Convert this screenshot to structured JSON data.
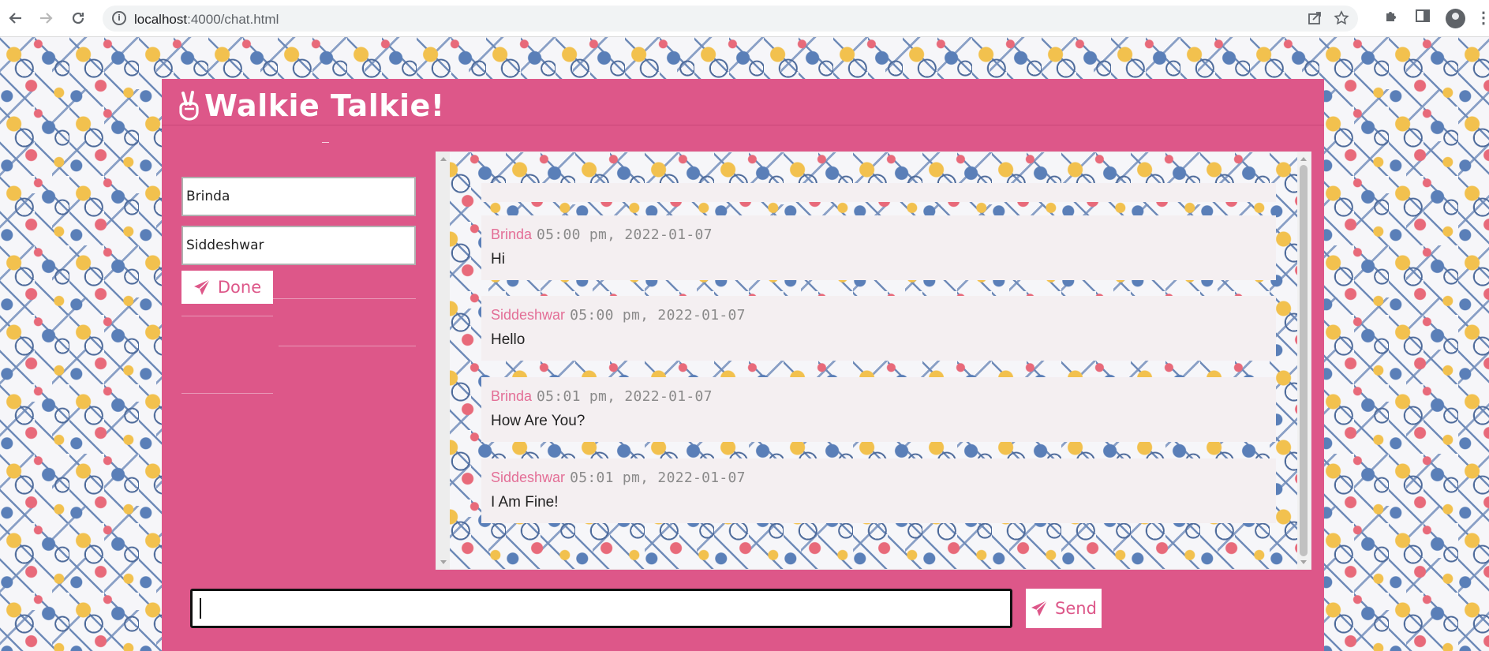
{
  "browser": {
    "url_host": "localhost",
    "url_rest": ":4000/chat.html"
  },
  "app": {
    "title": "Walkie Talkie!",
    "accent_color": "#dd5789"
  },
  "sidebar": {
    "sender_value": "Brinda",
    "receiver_value": "Siddeshwar",
    "done_label": "Done"
  },
  "messages": [
    {
      "sender": "Brinda",
      "time": "05:00 pm, 2022-01-07",
      "text": "Hi"
    },
    {
      "sender": "Siddeshwar",
      "time": "05:00 pm, 2022-01-07",
      "text": "Hello"
    },
    {
      "sender": "Brinda",
      "time": "05:01 pm, 2022-01-07",
      "text": "How Are You?"
    },
    {
      "sender": "Siddeshwar",
      "time": "05:01 pm, 2022-01-07",
      "text": "I Am Fine!"
    }
  ],
  "composer": {
    "value": "",
    "send_label": "Send"
  },
  "icons": {
    "back": "back-arrow-icon",
    "forward": "forward-arrow-icon",
    "reload": "reload-icon",
    "site_info": "info-icon",
    "share": "share-icon",
    "bookmark": "star-icon",
    "extensions": "puzzle-icon",
    "side_panel": "side-panel-icon",
    "profile": "profile-icon",
    "menu": "kebab-menu-icon",
    "logo": "peace-hand-icon",
    "send": "paper-plane-icon"
  }
}
